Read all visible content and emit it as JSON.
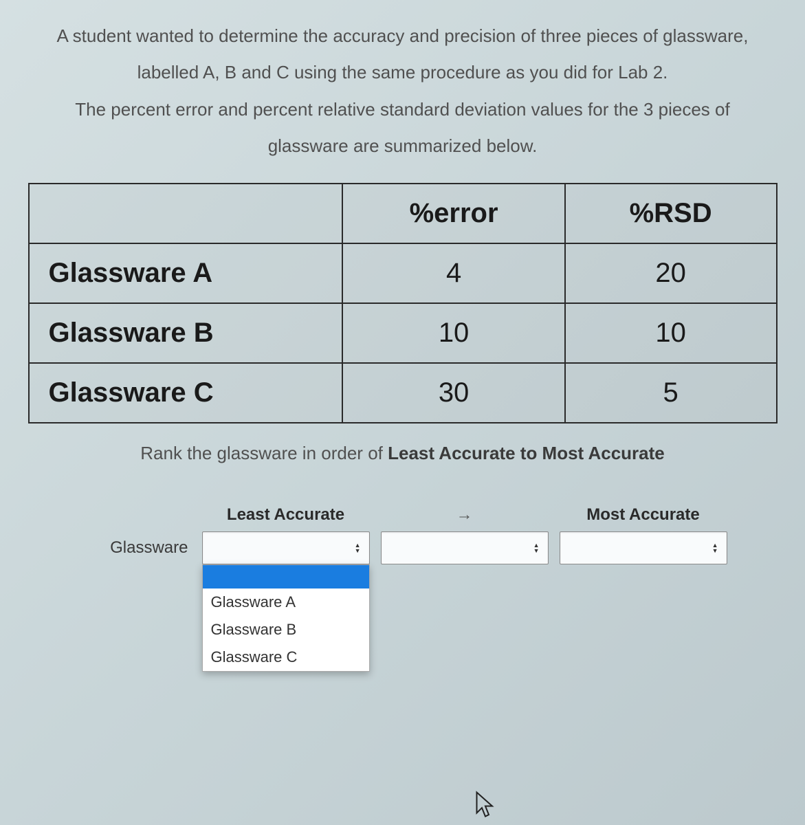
{
  "prompt": {
    "p1": "A student wanted to determine the accuracy and precision of three pieces of glassware,",
    "p2": "labelled A, B and C using the same procedure as you did for Lab 2.",
    "p3": "The percent error and percent relative standard deviation values for the 3 pieces of",
    "p4": "glassware are summarized below."
  },
  "table": {
    "headers": {
      "c0": "",
      "c1": "%error",
      "c2": "%RSD"
    },
    "rows": [
      {
        "name": "Glassware A",
        "error": "4",
        "rsd": "20"
      },
      {
        "name": "Glassware B",
        "error": "10",
        "rsd": "10"
      },
      {
        "name": "Glassware C",
        "error": "30",
        "rsd": "5"
      }
    ]
  },
  "rank": {
    "instruction_prefix": "Rank the glassware in order of ",
    "instruction_bold": "Least Accurate to Most Accurate",
    "headers": {
      "least": "Least Accurate",
      "arrow": "→",
      "most": "Most Accurate"
    },
    "row_label": "Glassware",
    "dropdown_options": [
      {
        "label": ""
      },
      {
        "label": "Glassware A"
      },
      {
        "label": "Glassware B"
      },
      {
        "label": "Glassware C"
      }
    ]
  }
}
